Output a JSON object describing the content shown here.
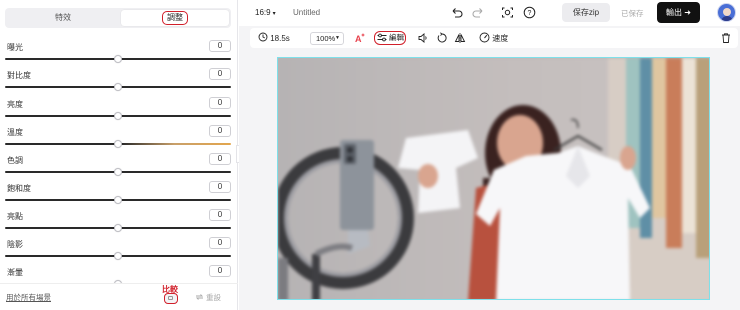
{
  "left_panel": {
    "tabs": {
      "effects": "特效",
      "adjust": "調整"
    },
    "sliders": [
      {
        "label": "曝光",
        "value": "0",
        "level": 0.5
      },
      {
        "label": "對比度",
        "value": "0",
        "level": 0.5
      },
      {
        "label": "亮度",
        "value": "0",
        "level": 0.5
      },
      {
        "label": "溫度",
        "value": "0",
        "level": 0.5
      },
      {
        "label": "色調",
        "value": "0",
        "level": 0.5
      },
      {
        "label": "飽和度",
        "value": "0",
        "level": 0.5
      },
      {
        "label": "亮點",
        "value": "0",
        "level": 0.5
      },
      {
        "label": "陰影",
        "value": "0",
        "level": 0.5
      },
      {
        "label": "漸暈",
        "value": "0",
        "level": 0.5
      }
    ],
    "apply_all": "用於所有場景",
    "compare_label": "比較",
    "reset_label": "重設"
  },
  "topbar": {
    "aspect_ratio": "16:9",
    "title": "Untitled",
    "save_zip": "保存zip",
    "saved_status": "已保存",
    "export": "輸出"
  },
  "toolbar": {
    "duration": "18.5s",
    "zoom": "100%",
    "edit": "編輯",
    "speed": "速度"
  },
  "colors": {
    "highlight": "#d11f2a",
    "canvas_border": "#7ee0ea",
    "export_bg": "#111111",
    "avatar": "#4a6fd6"
  },
  "icons": [
    "undo-icon",
    "redo-icon",
    "screen-record-icon",
    "help-icon",
    "arrow-right-icon",
    "clock-icon",
    "ai-text-icon",
    "edit-sliders-icon",
    "rotate-icon",
    "flip-icon",
    "speaker-icon",
    "speed-gauge-icon",
    "trash-icon",
    "reset-icon",
    "collapse-chevron-icon"
  ]
}
